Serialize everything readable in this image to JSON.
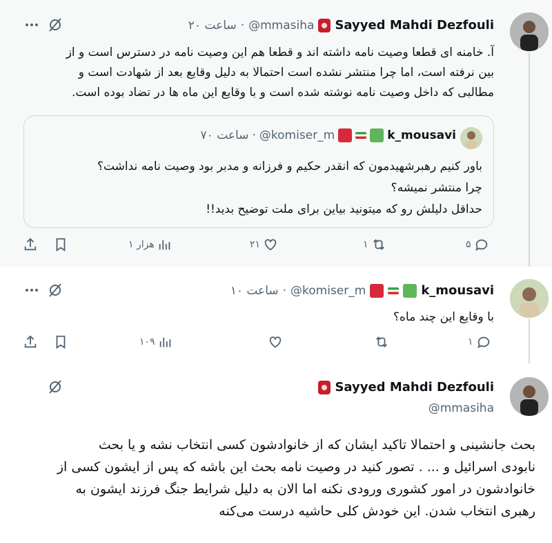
{
  "tweet1": {
    "name": "Sayyed Mahdi Dezfouli",
    "handle": "@mmasiha",
    "separator": "·",
    "time": "۲۰ ساعت",
    "text_lines": [
      "آ. خامنه ای قطعا وصیت نامه داشته اند و قطعا هم این وصیت نامه در دسترس است و از",
      "بین نرفته است، اما چرا منتشر نشده است احتمالا به دلیل وقایع بعد از شهادت است و",
      "مطالبی که داخل وصیت نامه نوشته شده است و با وقایع این ماه ها در تضاد بوده است."
    ],
    "quote": {
      "name": "k_mousavi",
      "handle": "@komiser_m",
      "separator": "·",
      "time": "۷۰ ساعت",
      "text_lines": [
        "باور کنیم رهبرشهیدمون که انقدر حکیم و فرزانه و مدبر بود وصیت نامه نداشت؟",
        "چرا منتشر نمیشه؟",
        "حداقل دلیلش رو که میتونید بیاین برای ملت توضیح بدید!!"
      ]
    },
    "actions": {
      "replies": "۵",
      "reposts": "۱",
      "likes": "۲۱",
      "views": "۱ هزار"
    }
  },
  "tweet2": {
    "name": "k_mousavi",
    "handle": "@komiser_m",
    "separator": "·",
    "time": "۱۰ ساعت",
    "text": "با وقایع این چند ماه؟",
    "actions": {
      "replies": "۱",
      "reposts": "",
      "likes": "",
      "views": "۱۰۹"
    }
  },
  "tweet3": {
    "name": "Sayyed Mahdi Dezfouli",
    "handle": "@mmasiha",
    "text_lines": [
      "بحث جانشینی و احتمالا تاکید ایشان که از خانوادشون کسی انتخاب نشه و یا بحث",
      "نابودی اسرائیل و ... . تصور کنید در وصیت نامه بحث این باشه که پس از ایشون کسی از",
      "خانوادشون در امور کشوری ورودی نکنه اما الان به دلیل شرایط جنگ فرزند ایشون به",
      "رهبری انتخاب شدن. این خودش کلی حاشیه درست می‌کنه"
    ]
  },
  "colors": {
    "text": "#0f1419",
    "muted": "#536471",
    "border": "#cfd9de",
    "highlight_bg": "#f7f9f9"
  },
  "icons": [
    "more-icon",
    "grok-icon",
    "reply-icon",
    "repost-icon",
    "like-icon",
    "views-icon",
    "bookmark-icon",
    "share-icon",
    "red-badge-icon",
    "green-flag-icon",
    "iran-flag-icon",
    "red-flag-icon"
  ]
}
